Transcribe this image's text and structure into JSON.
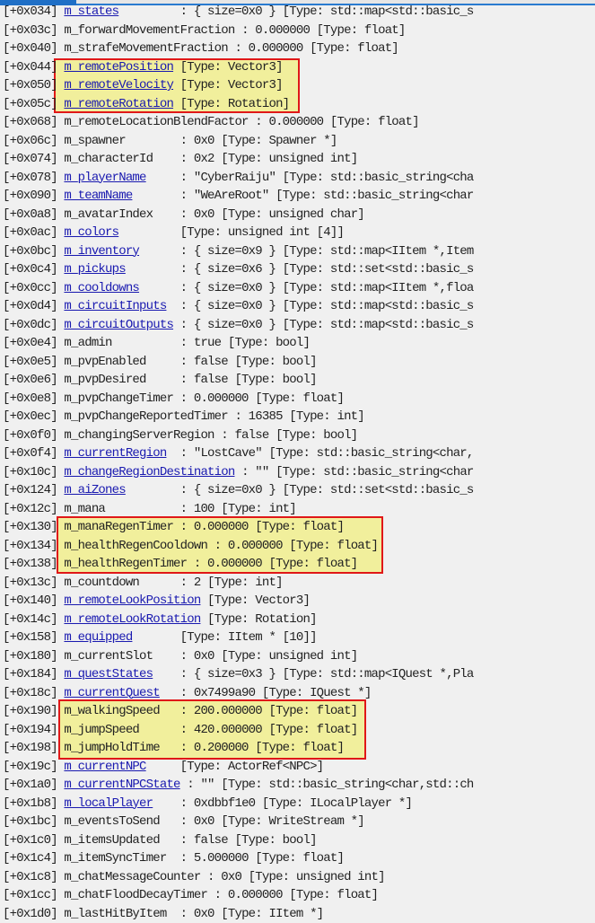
{
  "colors": {
    "background": "#f0f0f0",
    "link": "#1a1ab0",
    "highlight_fill": "#f1ef9c",
    "highlight_border": "#e01818",
    "accent": "#1f6fc6"
  },
  "highlight_groups": [
    [
      3,
      5
    ],
    [
      28,
      30
    ],
    [
      38,
      40
    ]
  ],
  "rows": [
    {
      "offset": "[+0x034]",
      "name": "m_states",
      "link": true,
      "rest": "         : { size=0x0 } [Type: std::map<std::basic_s"
    },
    {
      "offset": "[+0x03c]",
      "name": "m_forwardMovementFraction",
      "link": false,
      "rest": " : 0.000000 [Type: float]"
    },
    {
      "offset": "[+0x040]",
      "name": "m_strafeMovementFraction",
      "link": false,
      "rest": " : 0.000000 [Type: float]"
    },
    {
      "offset": "[+0x044]",
      "name": "m_remotePosition",
      "link": true,
      "rest": " [Type: Vector3]"
    },
    {
      "offset": "[+0x050]",
      "name": "m_remoteVelocity",
      "link": true,
      "rest": " [Type: Vector3]"
    },
    {
      "offset": "[+0x05c]",
      "name": "m_remoteRotation",
      "link": true,
      "rest": " [Type: Rotation]"
    },
    {
      "offset": "[+0x068]",
      "name": "m_remoteLocationBlendFactor",
      "link": false,
      "rest": " : 0.000000 [Type: float]"
    },
    {
      "offset": "[+0x06c]",
      "name": "m_spawner",
      "link": false,
      "rest": "        : 0x0 [Type: Spawner *]"
    },
    {
      "offset": "[+0x074]",
      "name": "m_characterId",
      "link": false,
      "rest": "    : 0x2 [Type: unsigned int]"
    },
    {
      "offset": "[+0x078]",
      "name": "m_playerName",
      "link": true,
      "rest": "     : \"CyberRaiju\" [Type: std::basic_string<cha"
    },
    {
      "offset": "[+0x090]",
      "name": "m_teamName",
      "link": true,
      "rest": "       : \"WeAreRoot\" [Type: std::basic_string<char"
    },
    {
      "offset": "[+0x0a8]",
      "name": "m_avatarIndex",
      "link": false,
      "rest": "    : 0x0 [Type: unsigned char]"
    },
    {
      "offset": "[+0x0ac]",
      "name": "m_colors",
      "link": true,
      "rest": "         [Type: unsigned int [4]]"
    },
    {
      "offset": "[+0x0bc]",
      "name": "m_inventory",
      "link": true,
      "rest": "      : { size=0x9 } [Type: std::map<IItem *,Item"
    },
    {
      "offset": "[+0x0c4]",
      "name": "m_pickups",
      "link": true,
      "rest": "        : { size=0x6 } [Type: std::set<std::basic_s"
    },
    {
      "offset": "[+0x0cc]",
      "name": "m_cooldowns",
      "link": true,
      "rest": "      : { size=0x0 } [Type: std::map<IItem *,floa"
    },
    {
      "offset": "[+0x0d4]",
      "name": "m_circuitInputs",
      "link": true,
      "rest": "  : { size=0x0 } [Type: std::map<std::basic_s"
    },
    {
      "offset": "[+0x0dc]",
      "name": "m_circuitOutputs",
      "link": true,
      "rest": " : { size=0x0 } [Type: std::map<std::basic_s"
    },
    {
      "offset": "[+0x0e4]",
      "name": "m_admin",
      "link": false,
      "rest": "          : true [Type: bool]"
    },
    {
      "offset": "[+0x0e5]",
      "name": "m_pvpEnabled",
      "link": false,
      "rest": "     : false [Type: bool]"
    },
    {
      "offset": "[+0x0e6]",
      "name": "m_pvpDesired",
      "link": false,
      "rest": "     : false [Type: bool]"
    },
    {
      "offset": "[+0x0e8]",
      "name": "m_pvpChangeTimer",
      "link": false,
      "rest": " : 0.000000 [Type: float]"
    },
    {
      "offset": "[+0x0ec]",
      "name": "m_pvpChangeReportedTimer",
      "link": false,
      "rest": " : 16385 [Type: int]"
    },
    {
      "offset": "[+0x0f0]",
      "name": "m_changingServerRegion",
      "link": false,
      "rest": " : false [Type: bool]"
    },
    {
      "offset": "[+0x0f4]",
      "name": "m_currentRegion",
      "link": true,
      "rest": "  : \"LostCave\" [Type: std::basic_string<char,"
    },
    {
      "offset": "[+0x10c]",
      "name": "m_changeRegionDestination",
      "link": true,
      "rest": " : \"\" [Type: std::basic_string<char"
    },
    {
      "offset": "[+0x124]",
      "name": "m_aiZones",
      "link": true,
      "rest": "        : { size=0x0 } [Type: std::set<std::basic_s"
    },
    {
      "offset": "[+0x12c]",
      "name": "m_mana",
      "link": false,
      "rest": "           : 100 [Type: int]"
    },
    {
      "offset": "[+0x130]",
      "name": "m_manaRegenTimer",
      "link": false,
      "rest": " : 0.000000 [Type: float]"
    },
    {
      "offset": "[+0x134]",
      "name": "m_healthRegenCooldown",
      "link": false,
      "rest": " : 0.000000 [Type: float]"
    },
    {
      "offset": "[+0x138]",
      "name": "m_healthRegenTimer",
      "link": false,
      "rest": " : 0.000000 [Type: float]"
    },
    {
      "offset": "[+0x13c]",
      "name": "m_countdown",
      "link": false,
      "rest": "      : 2 [Type: int]"
    },
    {
      "offset": "[+0x140]",
      "name": "m_remoteLookPosition",
      "link": true,
      "rest": " [Type: Vector3]"
    },
    {
      "offset": "[+0x14c]",
      "name": "m_remoteLookRotation",
      "link": true,
      "rest": " [Type: Rotation]"
    },
    {
      "offset": "[+0x158]",
      "name": "m_equipped",
      "link": true,
      "rest": "       [Type: IItem * [10]]"
    },
    {
      "offset": "[+0x180]",
      "name": "m_currentSlot",
      "link": false,
      "rest": "    : 0x0 [Type: unsigned int]"
    },
    {
      "offset": "[+0x184]",
      "name": "m_questStates",
      "link": true,
      "rest": "    : { size=0x3 } [Type: std::map<IQuest *,Pla"
    },
    {
      "offset": "[+0x18c]",
      "name": "m_currentQuest",
      "link": true,
      "rest": "   : 0x7499a90 [Type: IQuest *]"
    },
    {
      "offset": "[+0x190]",
      "name": "m_walkingSpeed",
      "link": false,
      "rest": "   : 200.000000 [Type: float]"
    },
    {
      "offset": "[+0x194]",
      "name": "m_jumpSpeed",
      "link": false,
      "rest": "      : 420.000000 [Type: float]"
    },
    {
      "offset": "[+0x198]",
      "name": "m_jumpHoldTime",
      "link": false,
      "rest": "   : 0.200000 [Type: float]"
    },
    {
      "offset": "[+0x19c]",
      "name": "m_currentNPC",
      "link": true,
      "rest": "     [Type: ActorRef<NPC>]"
    },
    {
      "offset": "[+0x1a0]",
      "name": "m_currentNPCState",
      "link": true,
      "rest": " : \"\" [Type: std::basic_string<char,std::ch"
    },
    {
      "offset": "[+0x1b8]",
      "name": "m_localPlayer",
      "link": true,
      "rest": "    : 0xdbbf1e0 [Type: ILocalPlayer *]"
    },
    {
      "offset": "[+0x1bc]",
      "name": "m_eventsToSend",
      "link": false,
      "rest": "   : 0x0 [Type: WriteStream *]"
    },
    {
      "offset": "[+0x1c0]",
      "name": "m_itemsUpdated",
      "link": false,
      "rest": "   : false [Type: bool]"
    },
    {
      "offset": "[+0x1c4]",
      "name": "m_itemSyncTimer",
      "link": false,
      "rest": "  : 5.000000 [Type: float]"
    },
    {
      "offset": "[+0x1c8]",
      "name": "m_chatMessageCounter",
      "link": false,
      "rest": " : 0x0 [Type: unsigned int]"
    },
    {
      "offset": "[+0x1cc]",
      "name": "m_chatFloodDecayTimer",
      "link": false,
      "rest": " : 0.000000 [Type: float]"
    },
    {
      "offset": "[+0x1d0]",
      "name": "m_lastHitByItem",
      "link": false,
      "rest": "  : 0x0 [Type: IItem *]"
    }
  ]
}
